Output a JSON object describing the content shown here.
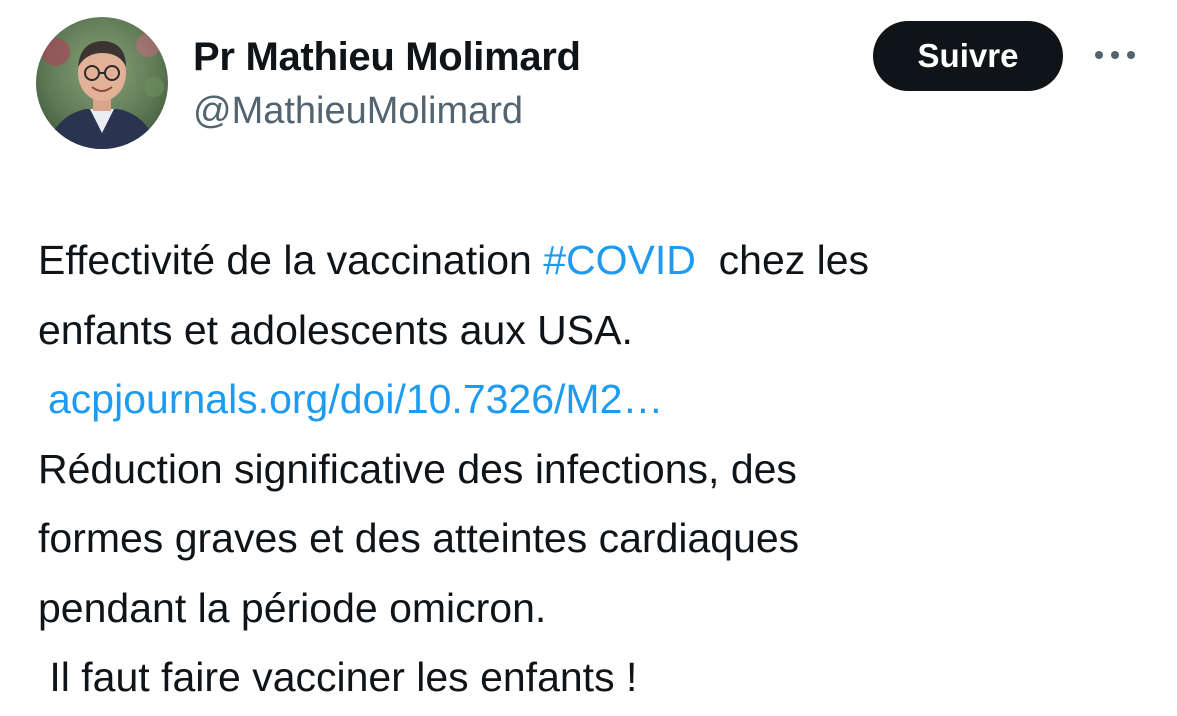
{
  "author": {
    "display_name": "Pr Mathieu Molimard",
    "handle": "@MathieuMolimard",
    "avatar_icon": "profile-photo"
  },
  "actions": {
    "follow_label": "Suivre",
    "more_icon": "more-icon"
  },
  "tweet": {
    "line1_text": "Effectivité de la vaccination ",
    "hashtag": "#COVID",
    "line1_after": "  chez les",
    "line2": "enfants et adolescents aux USA.",
    "link": "acpjournals.org/doi/10.7326/M2…",
    "line4": "Réduction significative des infections, des",
    "line5": "formes graves et des atteintes cardiaques",
    "line6": "pendant la période omicron.",
    "line7": " Il faut faire vacciner les enfants !"
  },
  "colors": {
    "link": "#1d9bf0",
    "text": "#0f1419",
    "secondary": "#536471",
    "button_bg": "#0f1419"
  }
}
